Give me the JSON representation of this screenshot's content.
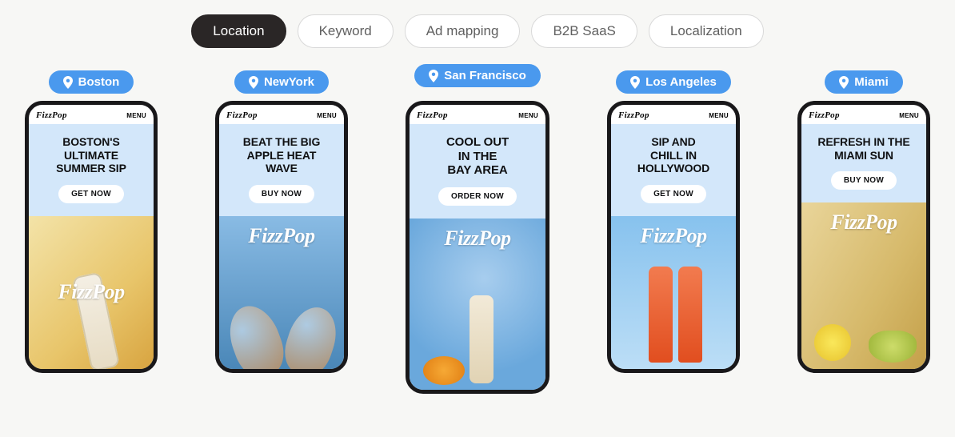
{
  "tabs": {
    "items": [
      {
        "label": "Location",
        "active": true
      },
      {
        "label": "Keyword",
        "active": false
      },
      {
        "label": "Ad mapping",
        "active": false
      },
      {
        "label": "B2B SaaS",
        "active": false
      },
      {
        "label": "Localization",
        "active": false
      }
    ]
  },
  "brand_logo_text": "FizzPop",
  "phone_menu_label": "MENU",
  "overlay_brand_text": "FizzPop",
  "phones": [
    {
      "location": "Boston",
      "featured": false,
      "headline": "BOSTON'S\nULTIMATE\nSUMMER SIP",
      "cta": "GET NOW",
      "scene": "boston",
      "overlay_pos": "center"
    },
    {
      "location": "NewYork",
      "featured": false,
      "headline": "BEAT THE BIG\nAPPLE HEAT\nWAVE",
      "cta": "BUY NOW",
      "scene": "ny",
      "overlay_pos": "top"
    },
    {
      "location": "San Francisco",
      "featured": true,
      "headline": "COOL OUT\nIN THE\nBAY AREA",
      "cta": "ORDER NOW",
      "scene": "sf",
      "overlay_pos": "top"
    },
    {
      "location": "Los Angeles",
      "featured": false,
      "headline": "SIP AND\nCHILL IN\nHOLLYWOOD",
      "cta": "GET NOW",
      "scene": "la",
      "overlay_pos": "top"
    },
    {
      "location": "Miami",
      "featured": false,
      "headline": "REFRESH IN THE\nMIAMI SUN",
      "cta": "BUY NOW",
      "scene": "miami",
      "overlay_pos": "top"
    }
  ]
}
